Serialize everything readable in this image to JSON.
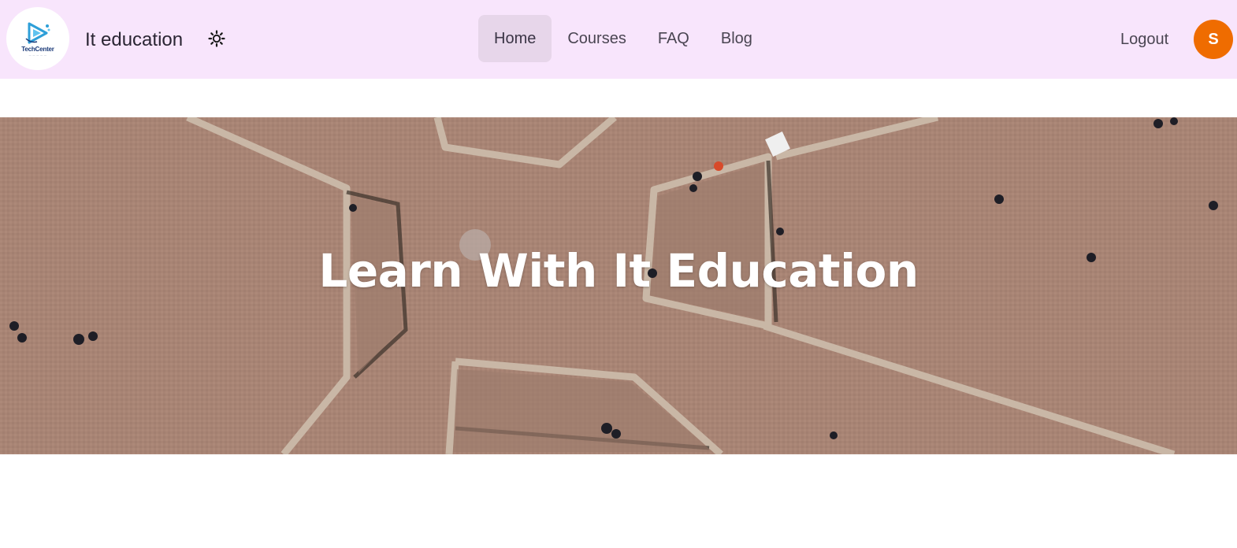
{
  "brand": {
    "logo_text": "TechCenter",
    "logo_icon": "play-triangle-logo",
    "title": "It education",
    "theme_icon": "sun-icon"
  },
  "nav": {
    "items": [
      {
        "label": "Home",
        "active": true
      },
      {
        "label": "Courses",
        "active": false
      },
      {
        "label": "FAQ",
        "active": false
      },
      {
        "label": "Blog",
        "active": false
      }
    ],
    "logout_label": "Logout",
    "avatar_initial": "S"
  },
  "hero": {
    "title": "Learn With It Education"
  },
  "colors": {
    "navbar_bg": "#f8e5fc",
    "active_tab_bg": "#e7d6ea",
    "avatar_bg": "#ef6c00",
    "hero_ground": "#a98575",
    "hero_title": "#ffffff"
  }
}
